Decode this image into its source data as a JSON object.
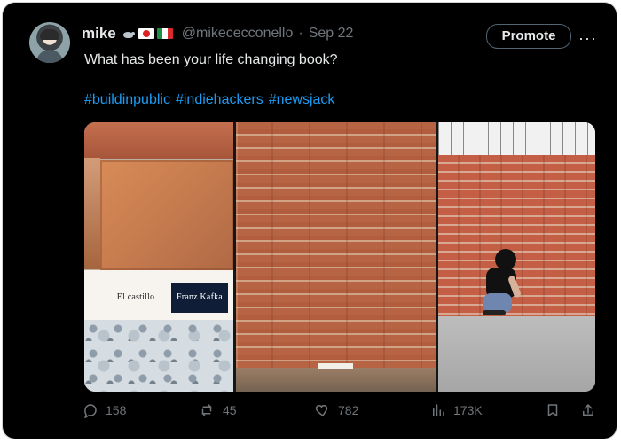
{
  "post": {
    "author_name": "mike",
    "handle": "@mikececconello",
    "separator": "·",
    "date": "Sep 22",
    "promote_label": "Promote",
    "more_label": "···",
    "text": "What has been your life changing book?",
    "hashtags": [
      "#buildinpublic",
      "#indiehackers",
      "#newsjack"
    ]
  },
  "media": {
    "book_title_left": "El castillo",
    "book_title_right": "Franz Kafka"
  },
  "actions": {
    "replies": "158",
    "reposts": "45",
    "likes": "782",
    "views": "173K"
  },
  "icons": {
    "reply": "comment-icon",
    "repost": "repost-icon",
    "like": "heart-icon",
    "views": "analytics-icon",
    "bookmark": "bookmark-icon",
    "share": "share-icon"
  },
  "colors": {
    "background": "#000000",
    "text": "#e7e9ea",
    "muted": "#71767b",
    "link": "#1d9bf0"
  }
}
